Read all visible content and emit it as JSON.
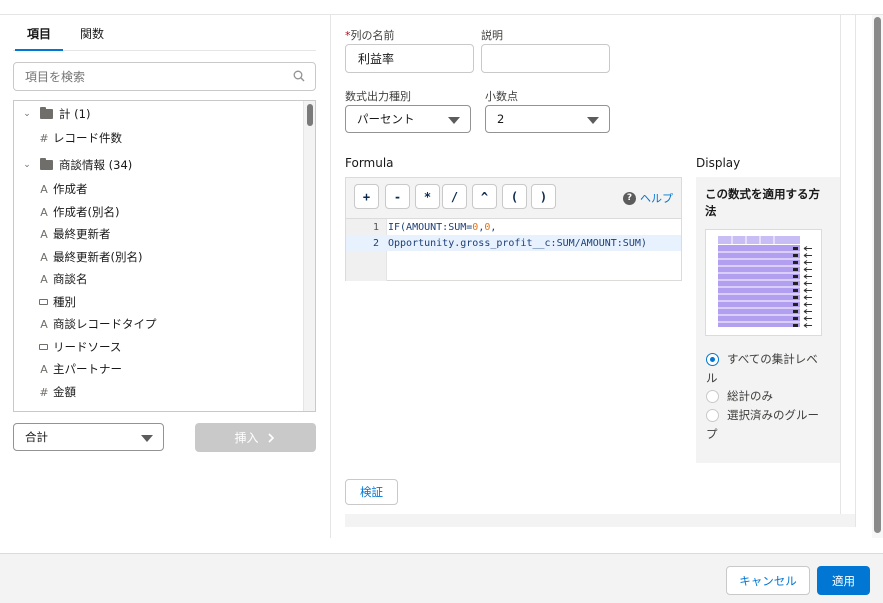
{
  "tabs": [
    {
      "label": "項目",
      "active": true
    },
    {
      "label": "関数",
      "active": false
    }
  ],
  "search": {
    "placeholder": "項目を検索",
    "icon": "search-icon"
  },
  "tree": {
    "groups": [
      {
        "label": "計 (1)",
        "items": [
          {
            "type": "#",
            "label": "レコード件数"
          }
        ]
      },
      {
        "label": "商談情報 (34)",
        "items": [
          {
            "type": "A",
            "label": "作成者"
          },
          {
            "type": "A",
            "label": "作成者(別名)"
          },
          {
            "type": "A",
            "label": "最終更新者"
          },
          {
            "type": "A",
            "label": "最終更新者(別名)"
          },
          {
            "type": "A",
            "label": "商談名"
          },
          {
            "type": "picklist",
            "label": "種別"
          },
          {
            "type": "A",
            "label": "商談レコードタイプ"
          },
          {
            "type": "picklist",
            "label": "リードソース"
          },
          {
            "type": "A",
            "label": "主パートナー"
          },
          {
            "type": "#",
            "label": "金額"
          }
        ]
      }
    ]
  },
  "aggregate_select": {
    "value": "合計"
  },
  "insert_button": {
    "label": "挿入",
    "icon": "chevron-right-icon"
  },
  "form": {
    "column_name": {
      "label": "列の名前",
      "required_mark": "*",
      "value": "利益率"
    },
    "description": {
      "label": "説明",
      "value": ""
    },
    "output_type": {
      "label": "数式出力種別",
      "value": "パーセント"
    },
    "decimals": {
      "label": "小数点",
      "value": "2"
    }
  },
  "formula": {
    "label": "Formula",
    "operators": [
      "+",
      "-",
      "*",
      "/",
      "^",
      "(",
      ")"
    ],
    "help_label": "ヘルプ",
    "lines": [
      {
        "n": "1",
        "pre": "IF(AMOUNT:SUM=",
        "n1": "0",
        "mid": ",",
        "n2": "0",
        "post": ","
      },
      {
        "n": "2",
        "text": "Opportunity.gross_profit__c:SUM/AMOUNT:SUM)"
      }
    ]
  },
  "display": {
    "label": "Display",
    "heading": "この数式を適用する方法",
    "options": [
      {
        "label": "すべての集計レベル",
        "selected": true
      },
      {
        "label": "総計のみ",
        "selected": false
      },
      {
        "label": "選択済みのグループ",
        "selected": false
      }
    ],
    "accent": "#b9a6ef"
  },
  "verify_button": {
    "label": "検証"
  },
  "footer": {
    "cancel_label": "キャンセル",
    "apply_label": "適用"
  },
  "colors": {
    "brand": "#0176d3",
    "required": "#ba0517"
  }
}
